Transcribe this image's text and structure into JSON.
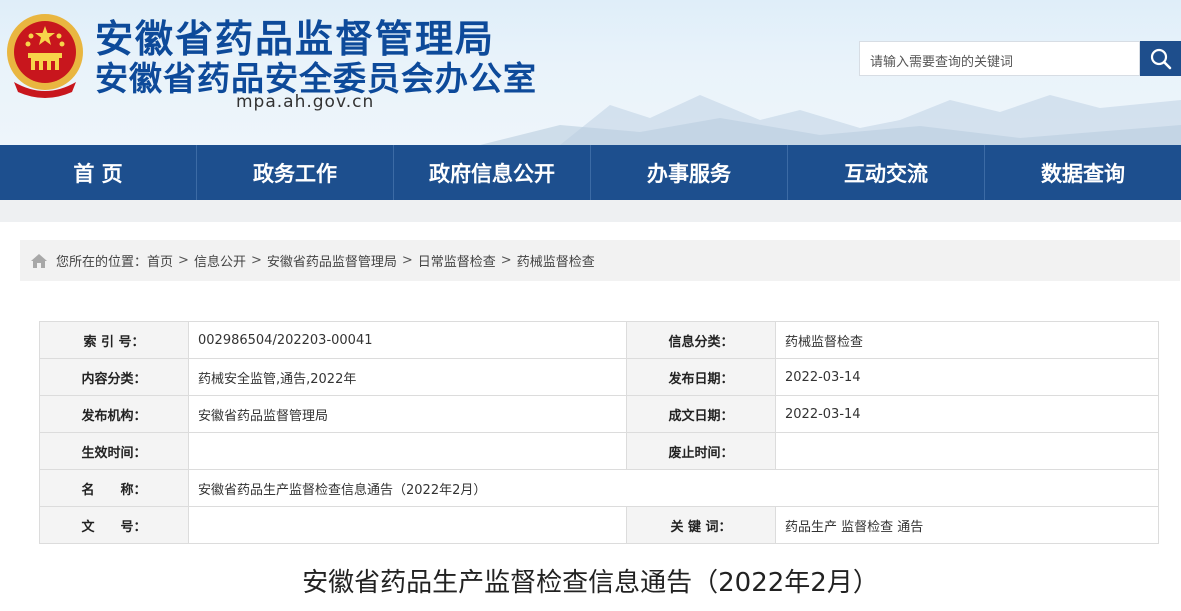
{
  "header": {
    "title_line1": "安徽省药品监督管理局",
    "title_line2": "安徽省药品安全委员会办公室",
    "domain": "mpa.ah.gov.cn",
    "emblem_icon": "national-emblem-icon",
    "colors": {
      "title": "#0d4a9a",
      "nav": "#1d4f8e",
      "search_button": "#1e4e8c"
    }
  },
  "search": {
    "placeholder": "请输入需要查询的关键词",
    "icon": "search-icon"
  },
  "nav": {
    "items": [
      {
        "label": "首 页"
      },
      {
        "label": "政务工作"
      },
      {
        "label": "政府信息公开"
      },
      {
        "label": "办事服务"
      },
      {
        "label": "互动交流"
      },
      {
        "label": "数据查询"
      }
    ]
  },
  "breadcrumb": {
    "prefix": "您所在的位置：",
    "icon": "home-icon",
    "items": [
      "首页",
      "信息公开",
      "安徽省药品监督管理局",
      "日常监督检查",
      "药械监督检查"
    ],
    "separator": ">"
  },
  "info_table": {
    "index_label": "索 引 号：",
    "index_value": "002986504/202203-00041",
    "category_label": "信息分类：",
    "category_value": "药械监督检查",
    "content_label": "内容分类：",
    "content_value": "药械安全监管,通告,2022年",
    "publish_date_label": "发布日期：",
    "publish_date_value": "2022-03-14",
    "org_label": "发布机构：",
    "org_value": "安徽省药品监督管理局",
    "written_date_label": "成文日期：",
    "written_date_value": "2022-03-14",
    "effective_label": "生效时间：",
    "effective_value": "",
    "expire_label": "废止时间：",
    "expire_value": "",
    "name_label": "名　　称：",
    "name_value": "安徽省药品生产监督检查信息通告（2022年2月）",
    "doc_no_label": "文　　号：",
    "doc_no_value": "",
    "keywords_label": "关 键 词：",
    "keywords_value": "药品生产 监督检查 通告"
  },
  "article": {
    "title": "安徽省药品生产监督检查信息通告（2022年2月）"
  }
}
